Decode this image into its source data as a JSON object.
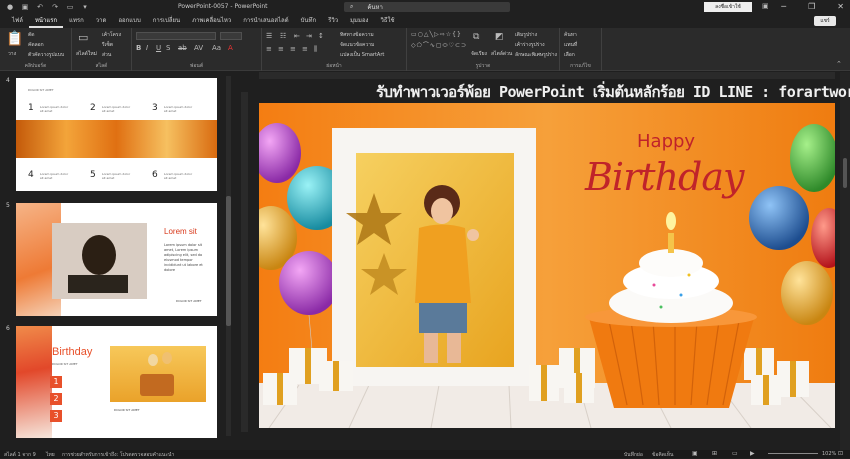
{
  "titlebar": {
    "doc_title": "PowerPoint-0057  -  PowerPoint",
    "search_placeholder": "ค้นหา",
    "signin_label": "ลงชื่อเข้าใช้",
    "window_min": "─",
    "window_restore": "❐",
    "window_close": "✕"
  },
  "tabs": [
    "ไฟล์",
    "หน้าแรก",
    "แทรก",
    "วาด",
    "ออกแบบ",
    "การเปลี่ยน",
    "ภาพเคลื่อนไหว",
    "การนำเสนอสไลด์",
    "บันทึก",
    "รีวิว",
    "มุมมอง",
    "วิธีใช้"
  ],
  "active_tab": "หน้าแรก",
  "share_label": "แชร์",
  "ribbon": {
    "groups": [
      "คลิปบอร์ด",
      "สไลด์",
      "ฟอนต์",
      "ย่อหน้า",
      "รูปวาด",
      "การแก้ไข"
    ],
    "paste": "วาง",
    "cut": "ตัด",
    "copy": "คัดลอก",
    "format_painter": "ตัวคัดวางรูปแบบ",
    "new_slide": "สไลด์ใหม่",
    "layout": "เค้าโครง",
    "reset": "รีเซ็ต",
    "section": "ส่วน",
    "text_direction": "ทิศทางข้อความ",
    "align_text": "จัดแนวข้อความ",
    "convert_smartart": "แปลงเป็น SmartArt",
    "arrange": "จัดเรียง",
    "quick_styles": "สไตล์ด่วน",
    "shape_fill": "เติมรูปร่าง",
    "shape_outline": "เค้าร่างรูปร่าง",
    "shape_effects": "ลักษณะพิเศษรูปร่าง",
    "find": "ค้นหา",
    "replace": "แทนที่",
    "select": "เลือก"
  },
  "thumbnails": [
    {
      "num": "4",
      "subtitle": "DOLOR SIT AMET",
      "items": [
        {
          "n": "1",
          "t": "Lorem ipsum dolor sit amet"
        },
        {
          "n": "2",
          "t": "Lorem ipsum dolor sit amet"
        },
        {
          "n": "3",
          "t": "Lorem ipsum dolor sit amet"
        },
        {
          "n": "4",
          "t": "Lorem ipsum dolor sit amet"
        },
        {
          "n": "5",
          "t": "Lorem ipsum dolor sit amet"
        },
        {
          "n": "6",
          "t": "Lorem ipsum dolor sit amet"
        }
      ]
    },
    {
      "num": "5",
      "title": "Lorem sit",
      "body": "Lorem ipsum dolor sit amet, Lorem ipsum adipiscing elit, sed do eiusmod tempor incididunt ut labore et dolore",
      "footer": "DOLOR SIT AMET"
    },
    {
      "num": "6",
      "title": "Birthday",
      "subtitle": "DOLOR SIT AMET",
      "items": [
        "1",
        "2",
        "3"
      ],
      "caption": "DOLOR SIT AMET"
    }
  ],
  "watermark": "รับทำพาวเวอร์พ้อย PowerPoint เริ่มต้นหลักร้อย ID LINE : forartwork",
  "slide": {
    "happy": "Happy",
    "birthday": "Birthday"
  },
  "status": {
    "slide_of": "สไลด์ 1 จาก 9",
    "language": "ไทย",
    "accessibility": "การช่วยสำหรับการเข้าถึง: โปรดตรวจสอบคำแนะนำ",
    "notes": "บันทึกย่อ",
    "display": "ข้อคิดเห็น",
    "zoom": "102%"
  },
  "colors": {
    "slide_orange": "#f28c1a",
    "birthday_red": "#c0232a"
  }
}
